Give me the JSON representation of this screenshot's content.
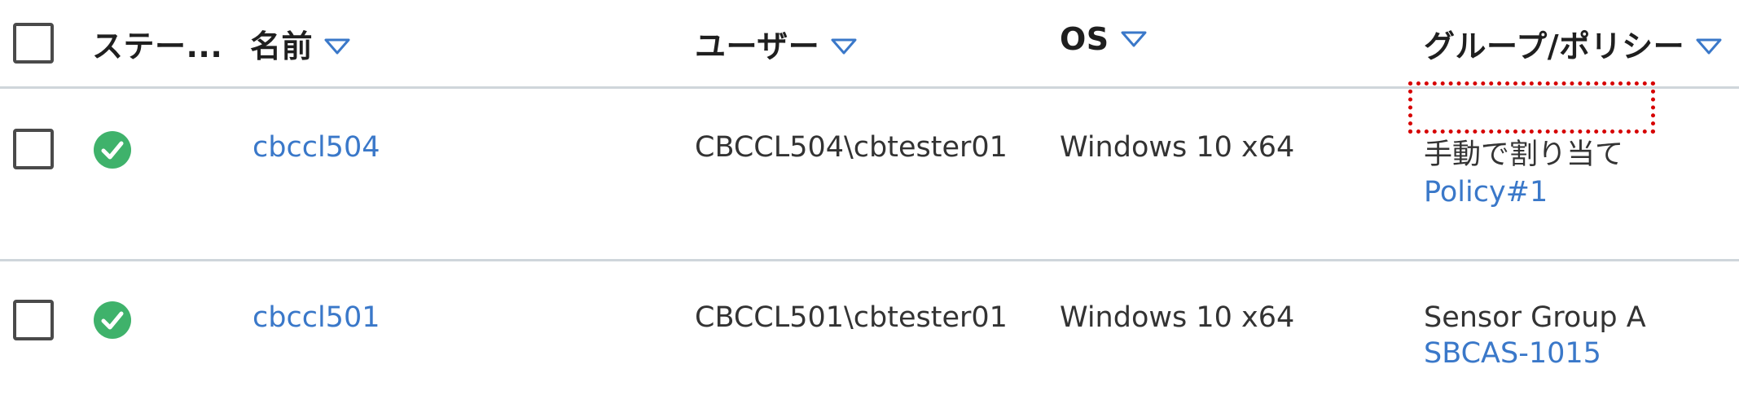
{
  "header": {
    "status_label": "ステー...",
    "name_label": "名前",
    "user_label": "ユーザー",
    "os_label": "OS",
    "group_policy_label": "グループ/ポリシー"
  },
  "rows": [
    {
      "status": "ok",
      "name": "cbccl504",
      "user": "CBCCL504\\cbtester01",
      "os": "Windows 10 x64",
      "group": "手動で割り当て",
      "policy": "Policy#1"
    },
    {
      "status": "ok",
      "name": "cbccl501",
      "user": "CBCCL501\\cbtester01",
      "os": "Windows 10 x64",
      "group": "Sensor Group A",
      "policy": "SBCAS-1015"
    }
  ],
  "colors": {
    "link": "#3a78c9",
    "status_ok": "#3fb26b",
    "sort_arrow": "#3a78c9",
    "highlight": "#d60000"
  }
}
